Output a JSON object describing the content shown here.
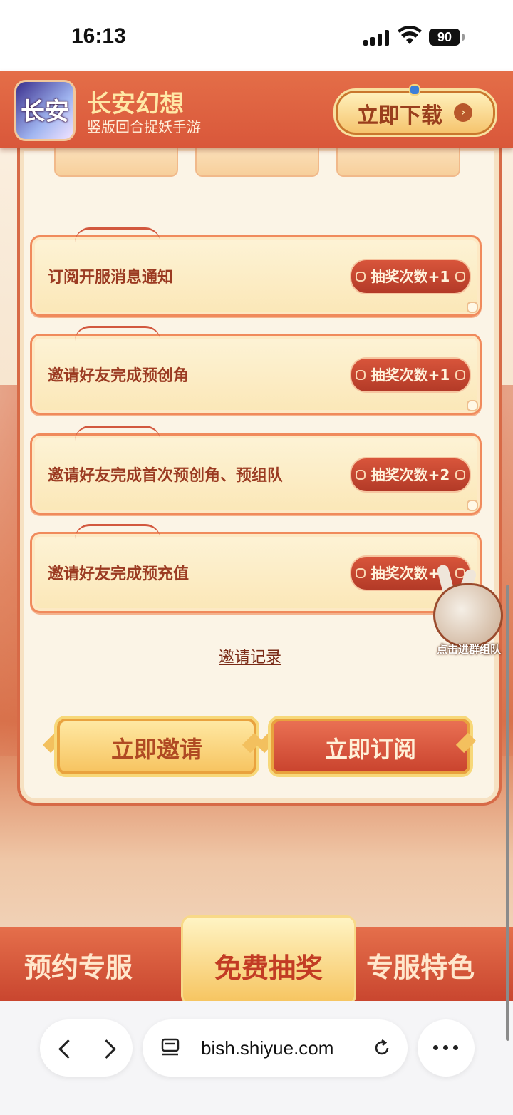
{
  "status_bar": {
    "time": "16:13",
    "battery": "90"
  },
  "banner": {
    "app_icon_text": "长安",
    "app_name": "长安幻想",
    "app_subtitle": "竖版回合捉妖手游",
    "download_label": "立即下载"
  },
  "tasks": [
    {
      "label": "订阅开服消息通知",
      "reward": "抽奖次数+1"
    },
    {
      "label": "邀请好友完成预创角",
      "reward": "抽奖次数+1"
    },
    {
      "label": "邀请好友完成首次预创角、预组队",
      "reward": "抽奖次数+2"
    },
    {
      "label": "邀请好友完成预充值",
      "reward": "抽奖次数+1"
    }
  ],
  "invite_record": "邀请记录",
  "buttons": {
    "invite": "立即邀请",
    "subscribe": "立即订阅"
  },
  "group_widget": {
    "label": "点击进群组队"
  },
  "bottom_nav": [
    {
      "label": "预约专服"
    },
    {
      "label": "免费抽奖",
      "active": true
    },
    {
      "label": "专服特色"
    }
  ],
  "browser": {
    "url": "bish.shiyue.com"
  }
}
